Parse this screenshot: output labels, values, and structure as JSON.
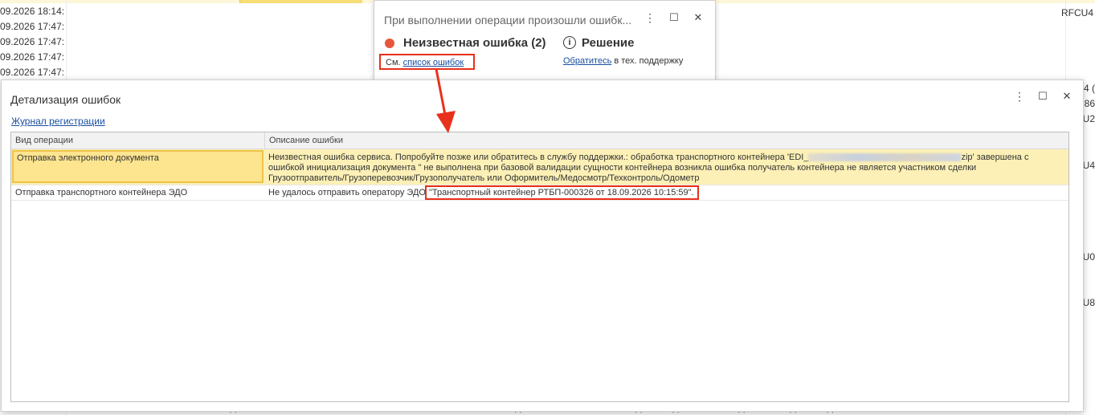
{
  "background": {
    "dates": [
      "09.2026 18:14:",
      "09.2026 17:47:",
      "09.2026 17:47:",
      "09.2026 17:47:",
      "09.2026 17:47:"
    ],
    "right_codes": [
      "RFCU4",
      "74 (",
      "U86",
      "/U2",
      "U4",
      "MU0",
      "U8"
    ],
    "bottom_fragments": [
      "ОЧЕНЕНИЕ",
      "ЭЛЕКТРОННОЕ ПОРУЧЕНИЕ ЭКСПЕДИТОРУ",
      "СОГЛАС",
      "РТСП-ДОЛЖНИКОВ ТОВАРЫ",
      "ПОДТВЕРЖДЕНО",
      "ОЖИДАЕТСЯ ПОДТВЕРЖДЕНИЕ"
    ]
  },
  "popup": {
    "title": "При выполнении операции произошли ошибк...",
    "error_label": "Неизвестная ошибка (2)",
    "solution_label": "Решение",
    "see_prefix": "См.",
    "see_link": "список ошибок",
    "support_link": "Обратитесь",
    "support_suffix": "в тех. поддержку",
    "more_icon": "⋮",
    "maximize_icon": "☐",
    "close_icon": "✕"
  },
  "dialog": {
    "title": "Детализация ошибок",
    "journal_link": "Журнал регистрации",
    "more_icon": "⋮",
    "maximize_icon": "☐",
    "close_icon": "✕",
    "columns": [
      "Вид операции",
      "Описание ошибки"
    ],
    "rows": [
      {
        "operation": "Отправка электронного документа",
        "desc_line1_a": "Неизвестная ошибка сервиса. Попробуйте позже или обратитесь в службу поддержки.: обработка транспортного контейнера 'EDI_",
        "desc_line1_b": "zip' завершена с",
        "desc_line2": "ошибкой инициализация документа \" не выполнена при базовой валидации сущности контейнера возникла ошибка получатель контейнера не является участником сделки",
        "desc_line3": "Грузоотправитель/Грузоперевозчик/Грузополучатель или Оформитель/Медосмотр/Техконтроль/Одометр"
      },
      {
        "operation": "Отправка транспортного контейнера ЭДО",
        "desc_prefix": "Не удалось отправить оператору ЭДО",
        "desc_highlight": "\"Транспортный контейнер РТБП-000326 от 18.09.2026 10:15:59\"."
      }
    ]
  },
  "colors": {
    "highlight_border": "#e8311b",
    "selected_row_bg": "#fcf0b6",
    "selected_cell_bg": "#fde48f",
    "link": "#1a4fa0",
    "error_dot": "#e8553b"
  }
}
